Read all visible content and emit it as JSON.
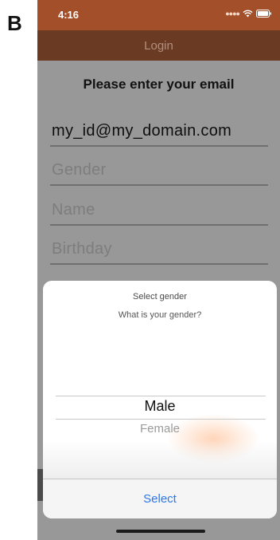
{
  "figure_label": "B",
  "status_bar": {
    "time": "4:16",
    "signal_icon": "signal-dots-icon",
    "wifi_icon": "wifi-icon",
    "battery_icon": "battery-icon"
  },
  "nav": {
    "title": "Login"
  },
  "form": {
    "prompt": "Please enter your email",
    "email_value": "my_id@my_domain.com",
    "gender_placeholder": "Gender",
    "name_placeholder": "Name",
    "birthday_placeholder": "Birthday"
  },
  "gender_sheet": {
    "title": "Select gender",
    "message": "What is your gender?",
    "options": [
      "Male",
      "Female"
    ],
    "selected": "Male",
    "select_label": "Select"
  },
  "colors": {
    "status_bar": "#a3502a",
    "nav_bar": "#6b3a22",
    "overlay": "#989898",
    "action_blue": "#2f77e6"
  }
}
